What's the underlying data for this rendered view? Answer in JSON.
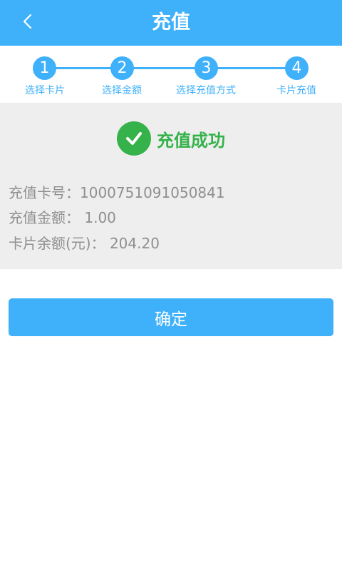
{
  "header": {
    "title": "充值",
    "back_icon": "chevron-left-icon"
  },
  "colors": {
    "primary": "#3fb0fa",
    "success": "#35b24a",
    "panel_bg": "#eeeeee",
    "info_text": "#8f8f8f"
  },
  "steps": [
    {
      "number": "1",
      "label": "选择卡片"
    },
    {
      "number": "2",
      "label": "选择金额"
    },
    {
      "number": "3",
      "label": "选择充值方式"
    },
    {
      "number": "4",
      "label": "卡片充值"
    }
  ],
  "result": {
    "status_icon": "check-circle-icon",
    "status_text": "充值成功",
    "card_number_line": "充值卡号：1000751091050841",
    "amount_line": "充值金额： 1.00",
    "balance_line": "卡片余额(元)： 204.20"
  },
  "actions": {
    "confirm_label": "确定"
  }
}
